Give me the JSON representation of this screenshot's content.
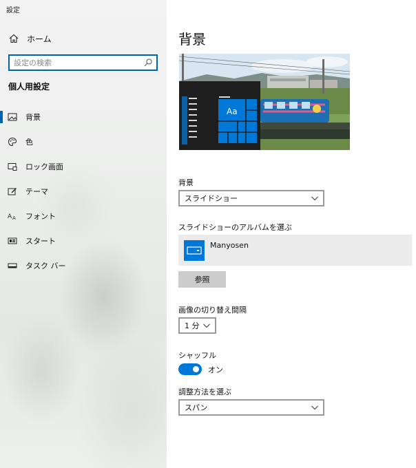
{
  "window": {
    "title": "設定"
  },
  "sidebar": {
    "home_label": "ホーム",
    "search_placeholder": "設定の検索",
    "section_title": "個人用設定",
    "items": [
      {
        "label": "背景",
        "icon": "picture-icon",
        "active": true
      },
      {
        "label": "色",
        "icon": "palette-icon",
        "active": false
      },
      {
        "label": "ロック画面",
        "icon": "lock-screen-icon",
        "active": false
      },
      {
        "label": "テーマ",
        "icon": "theme-icon",
        "active": false
      },
      {
        "label": "フォント",
        "icon": "font-icon",
        "active": false
      },
      {
        "label": "スタート",
        "icon": "start-icon",
        "active": false
      },
      {
        "label": "タスク バー",
        "icon": "taskbar-icon",
        "active": false
      }
    ]
  },
  "main": {
    "title": "背景",
    "preview": {
      "sample_text": "Aa"
    },
    "background": {
      "label": "背景",
      "value": "スライドショー"
    },
    "album": {
      "label": "スライドショーのアルバムを選ぶ",
      "name": "Manyosen",
      "browse_label": "参照"
    },
    "interval": {
      "label": "画像の切り替え間隔",
      "value": "1 分"
    },
    "shuffle": {
      "label": "シャッフル",
      "state_label": "オン",
      "on": true
    },
    "fit": {
      "label": "調整方法を選ぶ",
      "value": "スパン"
    }
  },
  "colors": {
    "accent": "#0078d7",
    "focus_border": "#0063b1"
  }
}
